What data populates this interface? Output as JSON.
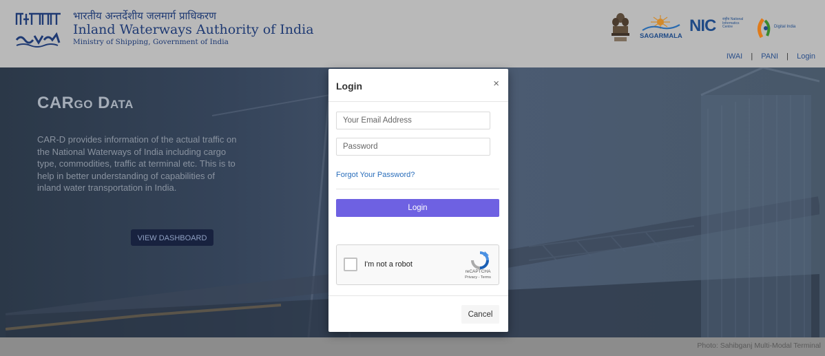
{
  "header": {
    "logo_text": "भाअजप्रा IWAI",
    "title_hindi": "भारतीय अन्तर्देशीय जलमार्ग प्राधिकरण",
    "title_english": "Inland Waterways Authority of India",
    "subtitle": "Ministry of Shipping, Government of India",
    "partners": {
      "sagarmala": "SAGARMALA",
      "nic": "NIC",
      "nic_sub": "राष्ट्रीय National Informatics Centre",
      "digital_india": "Digital India"
    },
    "links": [
      "IWAI",
      "PANI",
      "Login"
    ],
    "separator": "|"
  },
  "hero": {
    "title": "CARgo Data",
    "description": "CAR-D provides information of the actual traffic on the National Waterways of India including cargo type, commodities, traffic at terminal etc. This is to help in better understanding of capabilities of inland water transportation in India.",
    "button_label": "VIEW DASHBOARD"
  },
  "footer": {
    "photo_credit": "Photo: Sahibganj Multi-Modal Terminal"
  },
  "modal": {
    "title": "Login",
    "close_symbol": "×",
    "email_placeholder": "Your Email Address",
    "password_placeholder": "Password",
    "forgot_link": "Forgot Your Password?",
    "login_button": "Login",
    "captcha_label": "I'm not a robot",
    "captcha_brand": "reCAPTCHA",
    "captcha_terms": "Privacy - Terms",
    "cancel_button": "Cancel"
  },
  "colors": {
    "header_bg": "#b9b9b9",
    "brand_blue": "#1f3a73",
    "login_button": "#6e61e2",
    "dashboard_button": "#18223f"
  },
  "icons": [
    "iwai-logo-icon",
    "emblem-icon",
    "sagarmala-icon",
    "nic-icon",
    "digital-india-icon",
    "close-icon",
    "recaptcha-icon"
  ]
}
